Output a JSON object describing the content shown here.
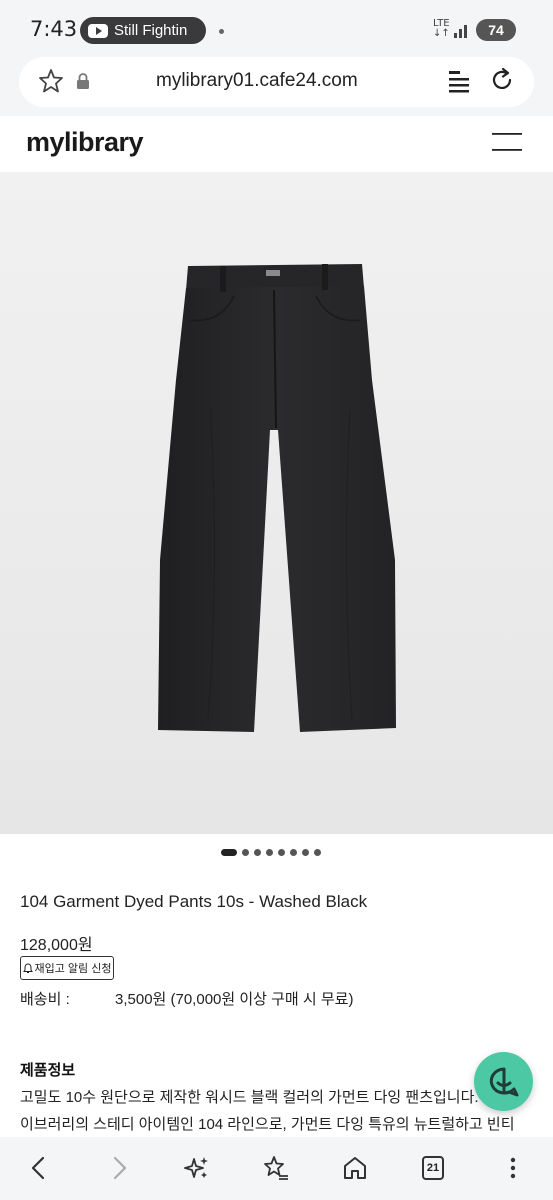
{
  "status_bar": {
    "time": "7:43",
    "media_label": "Still Fightin",
    "network": "LTE",
    "network_sub": "↓↑",
    "battery": "74"
  },
  "browser": {
    "url": "mylibrary01.cafe24.com",
    "icons": [
      "star-icon",
      "lock-icon",
      "reader-mode-icon",
      "reload-icon"
    ],
    "tab_count": "21"
  },
  "site": {
    "logo": "mylibrary",
    "menu_icon": "hamburger-icon"
  },
  "product": {
    "image_description_icon": "pants-photo",
    "carousel_count": 8,
    "carousel_active_index": 0,
    "title": "104 Garment Dyed Pants 10s - Washed Black",
    "price": "128,000원",
    "restock_button": "재입고 알림 신청",
    "shipping_label": "배송비 :",
    "shipping_value": "3,500원 (70,000원 이상 구매 시 무료)",
    "info_heading": "제품정보",
    "info_line_1": "고밀도 10수 원단으로 제작한 워시드 블랙 컬러의 가먼트 다잉 팬츠입니다.",
    "info_line_2": "이브러리의 스테디 아이템인 104 라인으로, 가먼트 다잉 특유의 뉴트럴하고 빈티"
  },
  "colors": {
    "chat_accent": "#4cc9a4",
    "pants": "#2a2a2c"
  },
  "bottom_nav": {
    "icons": [
      "back-icon",
      "forward-icon",
      "ai-sparkle-icon",
      "bookmark-star-icon",
      "home-icon",
      "tabs-icon",
      "more-icon"
    ]
  }
}
